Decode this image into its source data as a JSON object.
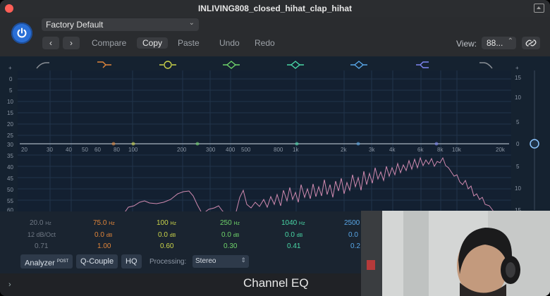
{
  "window": {
    "title": "INLIVING808_closed_hihat_clap_hihat"
  },
  "header": {
    "preset": "Factory Default",
    "buttons": {
      "compare": "Compare",
      "copy": "Copy",
      "paste": "Paste",
      "undo": "Undo",
      "redo": "Redo"
    },
    "view_label": "View:",
    "view_value": "88..."
  },
  "eq": {
    "left_db_ticks": [
      "+",
      "0",
      "5",
      "10",
      "15",
      "20",
      "25",
      "30",
      "35",
      "40",
      "45",
      "50",
      "55",
      "60"
    ],
    "right_gain_ticks": [
      "+",
      "15",
      "10",
      "5",
      "0",
      "5",
      "10",
      "15"
    ],
    "freq_ticks": [
      "20",
      "30",
      "40",
      "50",
      "60",
      "80",
      "100",
      "200",
      "300",
      "400",
      "500",
      "800",
      "1k",
      "2k",
      "3k",
      "4k",
      "6k",
      "8k",
      "10k",
      "20k"
    ],
    "bands": [
      {
        "freq": "20.0",
        "unit": "Hz",
        "gain": "12 dB/Oct",
        "q": "0.71",
        "color": "#6f7884"
      },
      {
        "freq": "75.0",
        "unit": "Hz",
        "gain": "0.0",
        "gain_unit": "dB",
        "q": "1.00",
        "color": "#e0853a"
      },
      {
        "freq": "100",
        "unit": "Hz",
        "gain": "0.0",
        "gain_unit": "dB",
        "q": "0.60",
        "color": "#cbd44a"
      },
      {
        "freq": "250",
        "unit": "Hz",
        "gain": "0.0",
        "gain_unit": "dB",
        "q": "0.30",
        "color": "#6fd36a"
      },
      {
        "freq": "1040",
        "unit": "Hz",
        "gain": "0.0",
        "gain_unit": "dB",
        "q": "0.41",
        "color": "#49d7a6"
      },
      {
        "freq": "2500",
        "unit": "",
        "gain": "0.0",
        "gain_unit": "",
        "q": "0.2",
        "color": "#58a6e6"
      }
    ],
    "band_icon_colors": [
      "#8a8f95",
      "#e0853a",
      "#cbd44a",
      "#6fd36a",
      "#49d7a6",
      "#58a6e6",
      "#7f86f2",
      "#8a8f95"
    ]
  },
  "controls": {
    "analyzer": "Analyzer",
    "analyzer_sup": "POST",
    "qcouple": "Q-Couple",
    "hq": "HQ",
    "processing_label": "Processing:",
    "processing_value": "Stereo"
  },
  "footer": {
    "plugin_name": "Channel EQ"
  }
}
